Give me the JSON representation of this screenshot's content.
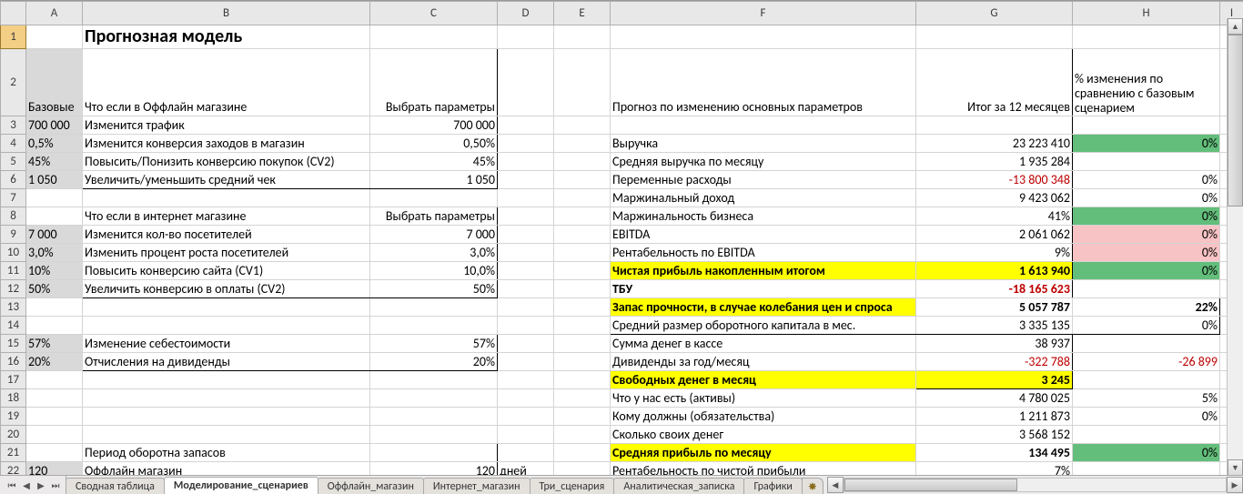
{
  "columns": [
    "A",
    "B",
    "C",
    "D",
    "E",
    "F",
    "G",
    "H",
    "I"
  ],
  "title": "Прогнозная модель",
  "colA_header": "Базовые",
  "colB_offline_header": "Что если в Оффлайн магазине",
  "colC_header": "Выбрать параметры",
  "colB_online_header": "Что если в интернет магазине",
  "colC_header2": "Выбрать параметры",
  "colF_header": "Прогноз по изменению основных параметров",
  "colG_header": "Итог за 12 месяцев",
  "colH_header": "% изменения по сравнению с базовым сценарием",
  "rows_left": {
    "r3": {
      "A": "700 000",
      "B": "Изменится трафик",
      "C": "700 000"
    },
    "r4": {
      "A": "0,5%",
      "B": "Изменится конверсия заходов в магазин",
      "C": "0,50%"
    },
    "r5": {
      "A": "45%",
      "B": "Повысить/Понизить конверсию покупок (CV2)",
      "C": "45%"
    },
    "r6": {
      "A": "1 050",
      "B": "Увеличить/уменьшить средний чек",
      "C": "1 050"
    },
    "r9": {
      "A": "7 000",
      "B": "Изменится кол-во посетителей",
      "C": "7 000"
    },
    "r10": {
      "A": "3,0%",
      "B": "Изменить процент роста посетителей",
      "C": "3,0%"
    },
    "r11": {
      "A": "10%",
      "B": "Повысить конверсию сайта (CV1)",
      "C": "10,0%"
    },
    "r12": {
      "A": "50%",
      "B": "Увеличить конверсию в оплаты (CV2)",
      "C": "50%"
    },
    "r15": {
      "A": "57%",
      "B": "Изменение себестоимости",
      "C": "57%"
    },
    "r16": {
      "A": "20%",
      "B": "Отчисления на дивиденды",
      "C": "20%"
    },
    "r21": {
      "B": "Период оборотна запасов"
    },
    "r22": {
      "A": "120",
      "B": "Оффлайн магазин",
      "C": "120",
      "D": "дней"
    }
  },
  "rows_right": {
    "r4": {
      "F": "Выручка",
      "G": "23 223 410",
      "H": "0%",
      "H_bg": "green"
    },
    "r5": {
      "F": "Средняя выручка по месяцу",
      "G": "1 935 284"
    },
    "r6": {
      "F": "Переменные расходы",
      "G": "-13 800 348",
      "G_red": true,
      "H": "0%"
    },
    "r7": {
      "F": "Маржинальный доход",
      "G": "9 423 062",
      "H": "0%"
    },
    "r8": {
      "F": "Маржинальность бизнеса",
      "G": "41%",
      "H": "0%",
      "H_bg": "green"
    },
    "r9": {
      "F": "EBITDA",
      "G": "2 061 062",
      "H": "0%",
      "H_bg": "pink"
    },
    "r10": {
      "F": "Рентабельность по EBITDA",
      "G": "9%",
      "H": "0%",
      "H_bg": "pink"
    },
    "r11": {
      "F": "Чистая прибыль накопленным итогом",
      "G": "1 613 940",
      "H": "0%",
      "F_bg": "yellow",
      "G_bg": "yellow",
      "H_bg": "green",
      "bold": true
    },
    "r12": {
      "F": "ТБУ",
      "G": "-18 165 623",
      "G_red": true,
      "bold": true
    },
    "r13": {
      "F": "Запас прочности, в случае колебания цен и спроса",
      "G": "5 057 787",
      "H": "22%",
      "F_bg": "yellow",
      "bold": true
    },
    "r14": {
      "F": "Средний размер оборотного капитала в мес.",
      "G": "3 335 135",
      "H": "0%"
    },
    "r15": {
      "F": "Сумма денег в кассе",
      "G": "38 937"
    },
    "r16": {
      "F": "Дивиденды за год/месяц",
      "G": "-322 788",
      "G_red": true,
      "H": "-26 899",
      "H_red": true
    },
    "r17": {
      "F": "Свободных денег в месяц",
      "G": "3 245",
      "F_bg": "yellow",
      "G_bg": "yellow",
      "bold": true
    },
    "r18": {
      "F": "Что у нас есть (активы)",
      "G": "4 780 025",
      "H": "5%"
    },
    "r19": {
      "F": "Кому должны (обязательства)",
      "G": "1 211 873",
      "H": "0%"
    },
    "r20": {
      "F": "Сколько своих денег",
      "G": "3 568 152"
    },
    "r21": {
      "F": "Средняя прибыль по месяцу",
      "G": "134 495",
      "H": "0%",
      "F_bg": "yellow",
      "H_bg": "green",
      "bold": true
    },
    "r22": {
      "F": "Рентабельность по чистой прибыли",
      "G": "7%"
    }
  },
  "tabs": [
    "Сводная таблица",
    "Моделирование_сценариев",
    "Оффлайн_магазин",
    "Интернет_магазин",
    "Три_сценария",
    "Аналитическая_записка",
    "Графики"
  ],
  "active_tab": 1
}
